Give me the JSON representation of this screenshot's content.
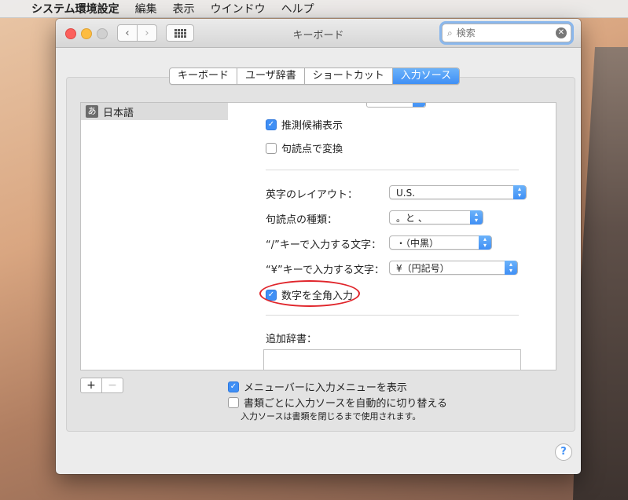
{
  "menubar": {
    "app_name": "システム環境設定",
    "items": [
      "編集",
      "表示",
      "ウインドウ",
      "ヘルプ"
    ]
  },
  "window": {
    "title": "キーボード",
    "search_placeholder": "検索"
  },
  "tabs": [
    {
      "label": "キーボード",
      "active": false
    },
    {
      "label": "ユーザ辞書",
      "active": false
    },
    {
      "label": "ショートカット",
      "active": false
    },
    {
      "label": "入力ソース",
      "active": true
    }
  ],
  "sources": [
    {
      "badge": "あ",
      "label": "日本語"
    }
  ],
  "settings": {
    "predict_label": "推測候補表示",
    "predict_checked": true,
    "punct_convert_label": "句読点で変換",
    "punct_convert_checked": false,
    "layout_label": "英字のレイアウト：",
    "layout_value": "U.S.",
    "punct_type_label": "句読点の種類：",
    "punct_type_value": "。と 、",
    "slash_label": "“/”キーで入力する文字：",
    "slash_value": "・（中黒）",
    "yen_label": "“¥”キーで入力する文字：",
    "yen_value": "¥（円記号）",
    "fullwidth_label": "数字を全角入力",
    "fullwidth_checked": true,
    "dict_label": "追加辞書："
  },
  "bottom": {
    "plus": "+",
    "minus": "−",
    "show_menu_label": "メニューバーに入力メニューを表示",
    "show_menu_checked": true,
    "auto_switch_label": "書類ごとに入力ソースを自動的に切り替える",
    "auto_switch_checked": false,
    "note": "入力ソースは書類を閉じるまで使用されます。",
    "help": "?"
  },
  "colors": {
    "accent": "#3f8ff5",
    "highlight_ring": "#e0252b"
  }
}
